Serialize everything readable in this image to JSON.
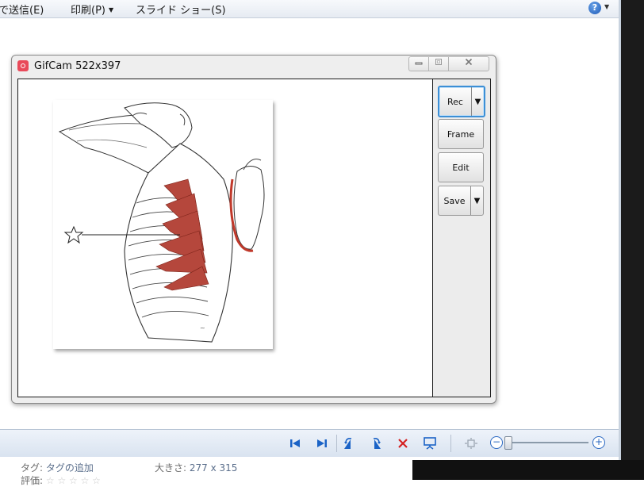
{
  "menu": {
    "items": [
      {
        "label": "で送信(E)",
        "has_caret": false
      },
      {
        "label": "印刷(P)",
        "has_caret": true
      },
      {
        "label": "スライド ショー(S)",
        "has_caret": false
      }
    ],
    "help_glyph": "?"
  },
  "gifcam": {
    "title": "GifCam 522x397",
    "buttons": {
      "rec": "Rec",
      "frame": "Frame",
      "edit": "Edit",
      "save": "Save"
    },
    "icons": {
      "app": "gifcam-icon",
      "minimize": "minimize-icon",
      "maximize": "maximize-icon",
      "close": "close-icon"
    }
  },
  "controls": {
    "icons": [
      "previous-icon",
      "next-icon",
      "rotate-left-icon",
      "rotate-right-icon",
      "delete-icon",
      "slideshow-icon",
      "fit-icon",
      "zoom-out-icon",
      "zoom-in-icon"
    ],
    "accent_color": "#1b63c6",
    "delete_color": "#d42020"
  },
  "info": {
    "tag_label": "タグ:",
    "tag_value": "タグの追加",
    "size_label": "大きさ:",
    "size_value": "277 x 315",
    "rating_label": "評価:"
  }
}
